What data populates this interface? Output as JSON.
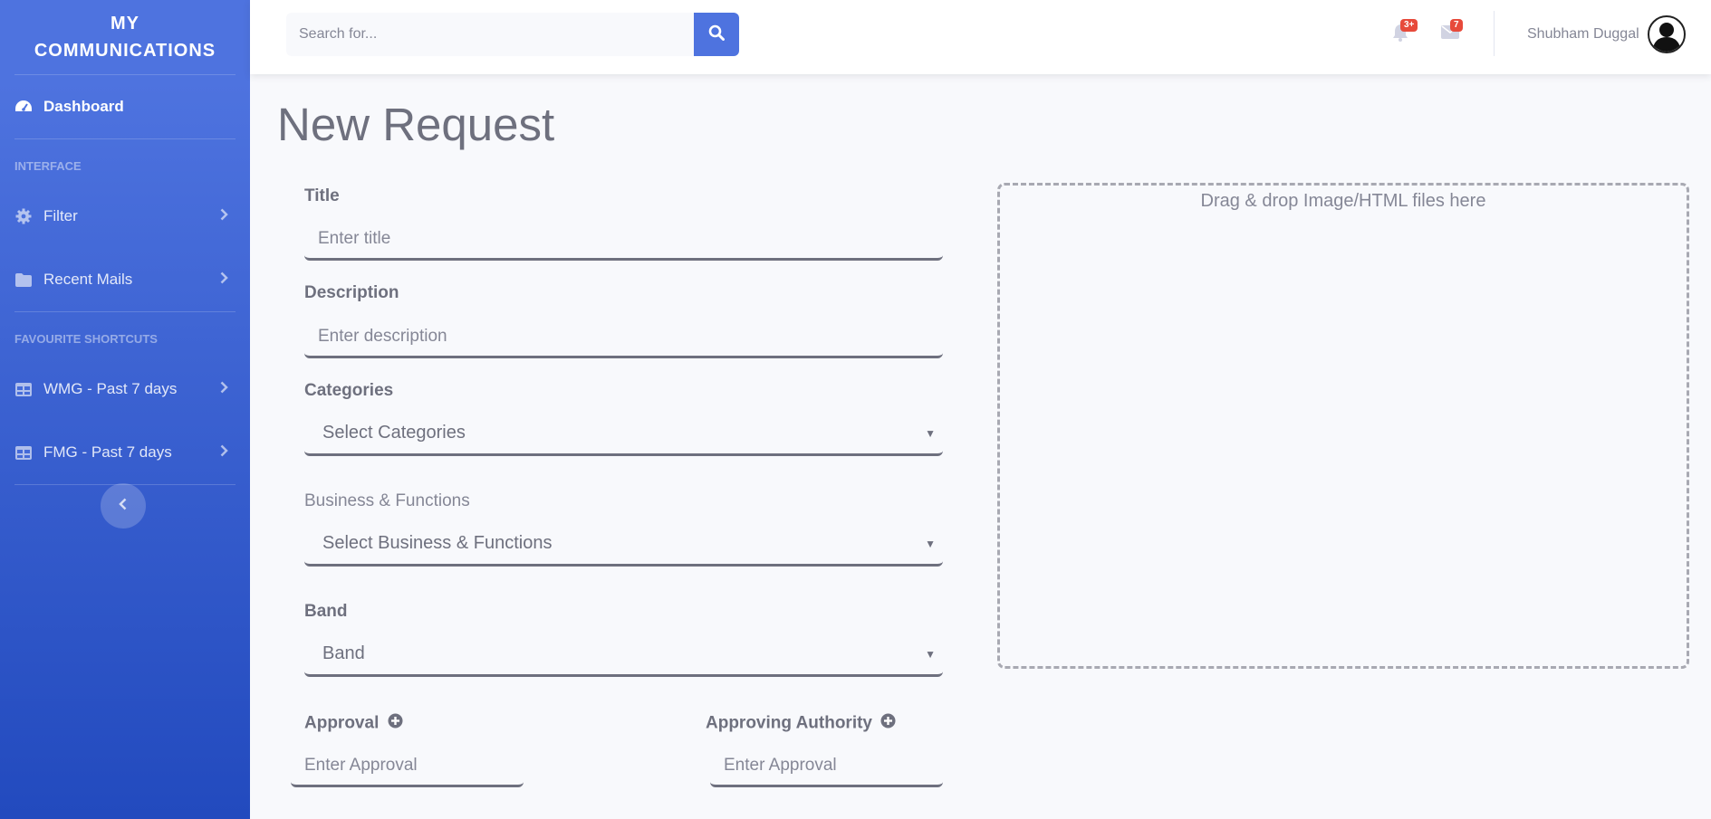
{
  "sidebar": {
    "brand": "MY COMMUNICATIONS",
    "dashboard": {
      "label": "Dashboard",
      "icon": "tachometer-icon"
    },
    "interface_heading": "INTERFACE",
    "interface_items": [
      {
        "label": "Filter",
        "icon": "gear-icon"
      },
      {
        "label": "Recent Mails",
        "icon": "folder-icon"
      }
    ],
    "shortcuts_heading": "FAVOURITE SHORTCUTS",
    "shortcut_items": [
      {
        "label": "WMG - Past 7 days",
        "icon": "table-icon"
      },
      {
        "label": "FMG - Past 7 days",
        "icon": "table-icon"
      }
    ],
    "toggle_icon": "chevron-left-icon"
  },
  "topbar": {
    "search_placeholder": "Search for...",
    "alerts_badge": "3+",
    "messages_badge": "7",
    "user_name": "Shubham Duggal"
  },
  "main": {
    "page_title": "New Request",
    "title_label": "Title",
    "title_placeholder": "Enter title",
    "description_label": "Description",
    "description_placeholder": "Enter description",
    "categories_label": "Categories",
    "categories_value": "Select Categories",
    "business_label": "Business & Functions",
    "business_value": "Select Business & Functions",
    "band_label": "Band",
    "band_value": "Band",
    "approval_label": "Approval",
    "approval_placeholder": "Enter Approval",
    "authority_label": "Approving Authority",
    "authority_placeholder": "Enter Approval",
    "dropzone_text": "Drag & drop Image/HTML files here"
  },
  "colors": {
    "primary": "#4e73df",
    "primary_dark": "#224abe",
    "badge": "#e74a3b",
    "text": "#6e707e",
    "muted": "#858796",
    "background": "#f8f9fc"
  }
}
